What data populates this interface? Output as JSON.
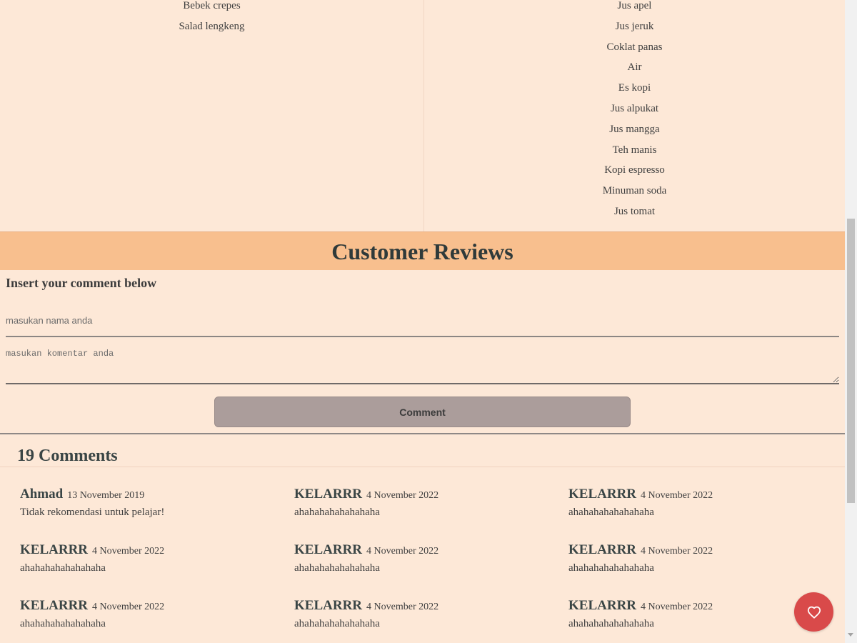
{
  "menu": {
    "left_items": [
      "Bebek crepes",
      "Salad lengkeng"
    ],
    "right_items": [
      "Jus apel",
      "Jus jeruk",
      "Coklat panas",
      "Air",
      "Es kopi",
      "Jus alpukat",
      "Jus mangga",
      "Teh manis",
      "Kopi espresso",
      "Minuman soda",
      "Jus tomat"
    ]
  },
  "reviews": {
    "title": "Customer Reviews",
    "insert_label": "Insert your comment below",
    "name_placeholder": "masukan nama anda",
    "comment_placeholder": "masukan komentar anda",
    "comment_button": "Comment",
    "count_label": "19 Comments"
  },
  "comments": [
    {
      "author": "Ahmad",
      "date": "13 November 2019",
      "text": "Tidak rekomendasi untuk pelajar!"
    },
    {
      "author": "KELARRR",
      "date": "4 November 2022",
      "text": "ahahahahahahahaha"
    },
    {
      "author": "KELARRR",
      "date": "4 November 2022",
      "text": "ahahahahahahahaha"
    },
    {
      "author": "KELARRR",
      "date": "4 November 2022",
      "text": "ahahahahahahahaha"
    },
    {
      "author": "KELARRR",
      "date": "4 November 2022",
      "text": "ahahahahahahahaha"
    },
    {
      "author": "KELARRR",
      "date": "4 November 2022",
      "text": "ahahahahahahahaha"
    },
    {
      "author": "KELARRR",
      "date": "4 November 2022",
      "text": "ahahahahahahahaha"
    },
    {
      "author": "KELARRR",
      "date": "4 November 2022",
      "text": "ahahahahahahahaha"
    },
    {
      "author": "KELARRR",
      "date": "4 November 2022",
      "text": "ahahahahahahahaha"
    }
  ],
  "colors": {
    "background": "#fde8d7",
    "header_band": "#f8bf8e",
    "button": "#ab9d9b",
    "favorite": "#d94a4a"
  },
  "icons": {
    "favorite": "heart-icon"
  }
}
